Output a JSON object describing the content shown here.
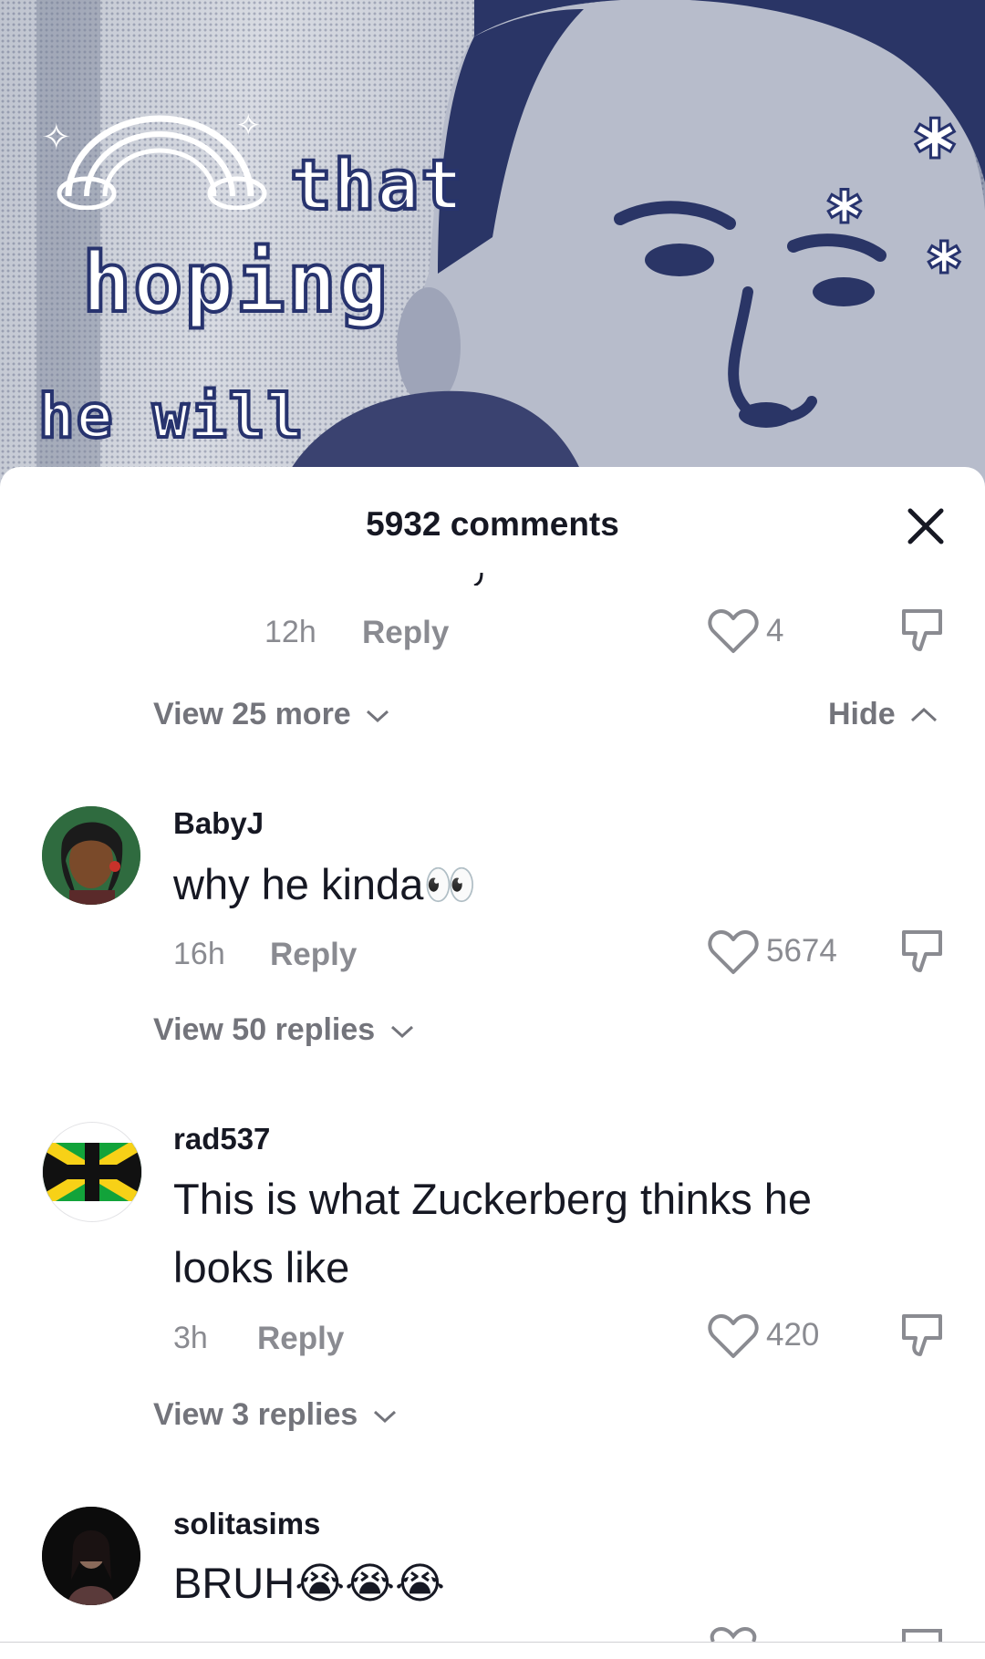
{
  "video": {
    "caption_words": [
      "that",
      "hoping",
      "he will"
    ]
  },
  "sheet": {
    "title": "5932 comments"
  },
  "partial_reply": {
    "time": "12h",
    "reply_label": "Reply",
    "likes": "4"
  },
  "thread_controls": {
    "view_more": "View 25 more",
    "hide": "Hide"
  },
  "comments": [
    {
      "username": "BabyJ",
      "text": "why he kinda",
      "emoji": "👀",
      "time": "16h",
      "reply_label": "Reply",
      "likes": "5674",
      "view_replies": "View 50 replies"
    },
    {
      "username": "rad537",
      "text_line1": "This is what Zuckerberg thinks he",
      "text_line2": "looks like",
      "time": "3h",
      "reply_label": "Reply",
      "likes": "420",
      "view_replies": "View 3 replies"
    },
    {
      "username": "solitasims",
      "text": "BRUH",
      "emoji": "😭😭😭"
    }
  ],
  "colors": {
    "accent_text": "#161823",
    "muted_text": "#8a8b91",
    "video_ink": "#27336e"
  }
}
